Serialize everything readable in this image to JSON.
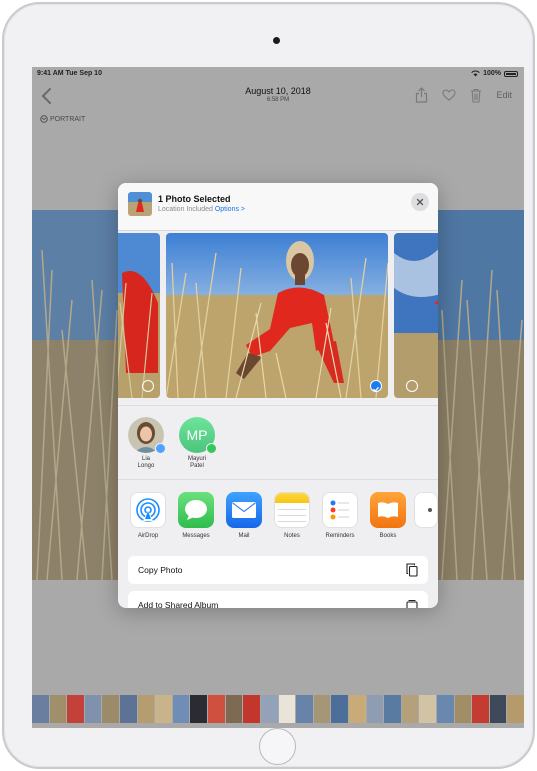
{
  "status_bar": {
    "time": "9:41 AM  Tue Sep 10",
    "battery": "100%"
  },
  "nav": {
    "date": "August 10, 2018",
    "time": "6:58 PM",
    "edit_label": "Edit"
  },
  "portrait_label": "PORTRAIT",
  "share_sheet": {
    "title": "1 Photo Selected",
    "subtitle": "Location Included",
    "options_label": "Options >",
    "people": [
      {
        "name": "Lia Longo",
        "line1": "Lia",
        "line2": "Longo",
        "initials": "",
        "badge_color": "#4da3ff"
      },
      {
        "name": "Mayuri Patel",
        "line1": "Mayuri",
        "line2": "Patel",
        "initials": "MP",
        "badge_color": "#34c759"
      }
    ],
    "apps": [
      {
        "label": "AirDrop",
        "icon": "airdrop-icon"
      },
      {
        "label": "Messages",
        "icon": "messages-icon"
      },
      {
        "label": "Mail",
        "icon": "mail-icon"
      },
      {
        "label": "Notes",
        "icon": "notes-icon"
      },
      {
        "label": "Reminders",
        "icon": "reminders-icon"
      },
      {
        "label": "Books",
        "icon": "books-icon"
      }
    ],
    "actions": [
      {
        "label": "Copy Photo",
        "icon": "copy-icon"
      },
      {
        "label": "Add to Shared Album",
        "icon": "shared-album-icon"
      }
    ]
  },
  "colors": {
    "accent": "#1a7cf0",
    "sky": "#4a8fd8",
    "grass": "#b9a374",
    "dress": "#e3271f"
  }
}
